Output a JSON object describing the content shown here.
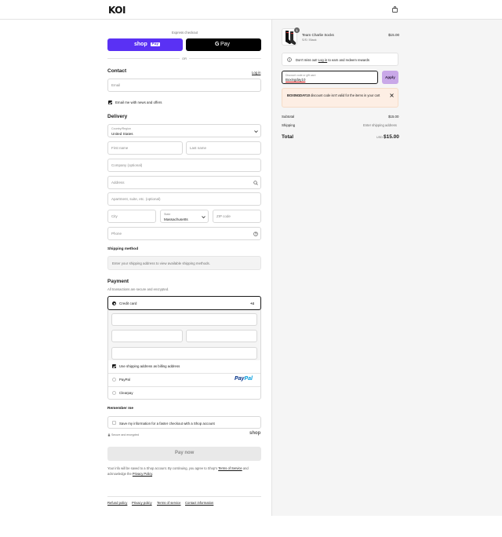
{
  "header": {
    "logo": "KOI",
    "cart_icon": "shopping-bag-icon"
  },
  "express": {
    "title": "Express checkout",
    "shop_pay": {
      "label_shop": "shop",
      "label_pay": "Pay",
      "color": "#5a31f4"
    },
    "gpay": {
      "label_g": "G",
      "label_pay": "Pay",
      "color": "#000000"
    },
    "or_label": "OR"
  },
  "contact": {
    "title": "Contact",
    "login_link": "Log in",
    "email_placeholder": "Email",
    "newsletter_label": "Email me with news and offers"
  },
  "delivery": {
    "title": "Delivery",
    "country_label": "Country/Region",
    "country_value": "United States",
    "first_name": "First name",
    "last_name": "Last name",
    "company": "Company (optional)",
    "address": "Address",
    "apartment": "Apartment, suite, etc. (optional)",
    "city": "City",
    "state_label": "State",
    "state_value": "Massachusetts",
    "zip": "ZIP code",
    "phone": "Phone"
  },
  "shipping_method": {
    "title": "Shipping method",
    "notice": "Enter your shipping address to view available shipping methods."
  },
  "payment": {
    "title": "Payment",
    "subtitle": "All transactions are secure and encrypted.",
    "credit_card": "Credit card",
    "more_badge": "+4",
    "billing_label": "Use shipping address as billing address",
    "paypal": "PayPal",
    "paypal_logo_p": "Pay",
    "paypal_logo_pal": "Pal",
    "clearpay": "Clearpay"
  },
  "remember": {
    "title": "Remember me",
    "save_label": "Save my information for a faster checkout with a Shop account",
    "secure": "Secure and encrypted",
    "shop_logo": "shop"
  },
  "pay_now": "Pay now",
  "terms": {
    "pre": "Your info will be saved to a Shop account. By continuing, you agree to Shop's ",
    "tos": "Terms of Service",
    "mid": " and acknowledge the ",
    "privacy": "Privacy Policy",
    "post": "."
  },
  "footer": {
    "links": [
      "Refund policy",
      "Privacy policy",
      "Terms of service",
      "Contact information"
    ]
  },
  "summary": {
    "item": {
      "qty": "1",
      "name": "Team Charlie Socks",
      "variant": "S/S / Black",
      "price": "$15.00"
    },
    "rewards": {
      "pre": "Don't miss out! ",
      "link": "Log in",
      "post": " to earn and redeem rewards"
    },
    "discount": {
      "label": "Discount code or gift card",
      "value": "Boxingday10",
      "apply": "Apply"
    },
    "error": {
      "code": "BOXINGDAY10",
      "message": " discount code isn't valid for the items in your cart"
    },
    "subtotal_label": "Subtotal",
    "subtotal_value": "$15.00",
    "shipping_label": "Shipping",
    "shipping_value": "Enter shipping address",
    "total_label": "Total",
    "currency": "USD",
    "total_value": "$15.00"
  }
}
